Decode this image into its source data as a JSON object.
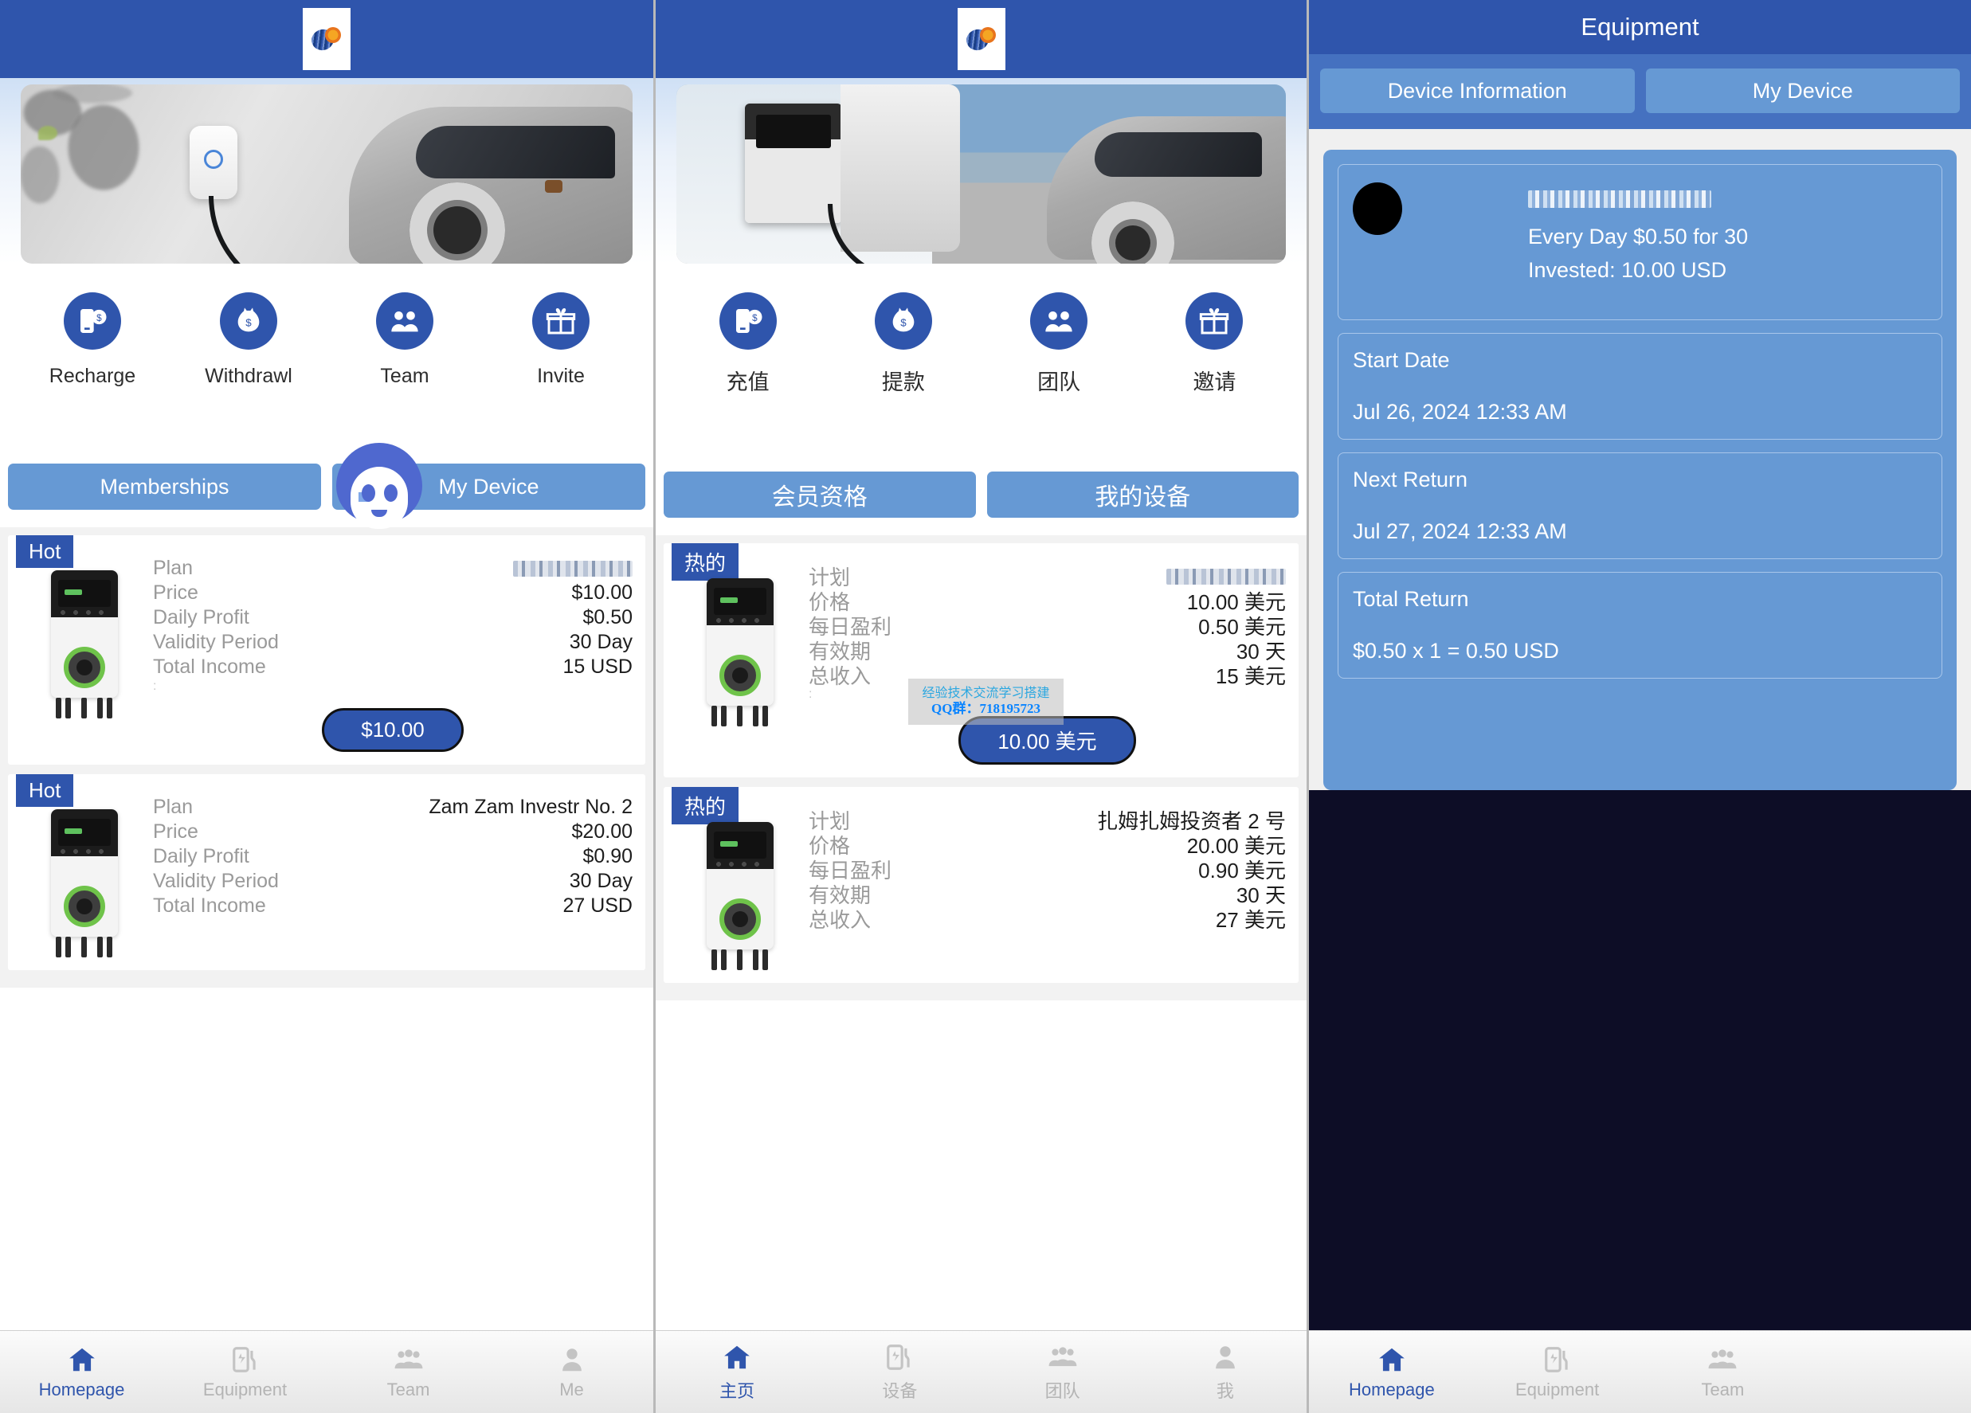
{
  "app": {
    "logo_name": "solar-globe-logo",
    "accent": "#2f55ac",
    "tab_blue": "#6699d4",
    "page_bg": "#f2f2f2"
  },
  "watermark": {
    "line1": "经验技术交流学习搭建",
    "line2": "QQ群：718195723"
  },
  "panel_en": {
    "actions": [
      {
        "label": "Recharge",
        "icon": "phone-dollar-icon"
      },
      {
        "label": "Withdrawl",
        "icon": "money-bag-icon"
      },
      {
        "label": "Team",
        "icon": "people-group-icon"
      },
      {
        "label": "Invite",
        "icon": "gift-icon"
      }
    ],
    "tabs": [
      {
        "label": "Memberships",
        "active": true
      },
      {
        "label": "My Device",
        "active": false
      }
    ],
    "plans": [
      {
        "badge": "Hot",
        "rows": [
          {
            "key": "Plan",
            "value": "",
            "blurred": true
          },
          {
            "key": "Price",
            "value": "$10.00",
            "blurred": false
          },
          {
            "key": "Daily Profit",
            "value": "$0.50",
            "blurred": false
          },
          {
            "key": "Validity Period",
            "value": "30 Day",
            "blurred": false
          },
          {
            "key": "Total Income",
            "value": "15 USD",
            "blurred": false
          }
        ],
        "buy_label": "$10.00"
      },
      {
        "badge": "Hot",
        "rows": [
          {
            "key": "Plan",
            "value": "Zam Zam Investr No. 2",
            "blurred": false
          },
          {
            "key": "Price",
            "value": "$20.00",
            "blurred": false
          },
          {
            "key": "Daily Profit",
            "value": "$0.90",
            "blurred": false
          },
          {
            "key": "Validity Period",
            "value": "30 Day",
            "blurred": false
          },
          {
            "key": "Total Income",
            "value": "27 USD",
            "blurred": false
          }
        ],
        "buy_label": ""
      }
    ],
    "nav": [
      {
        "label": "Homepage",
        "icon": "home-icon",
        "active": true
      },
      {
        "label": "Equipment",
        "icon": "charger-icon",
        "active": false
      },
      {
        "label": "Team",
        "icon": "people-icon",
        "active": false
      },
      {
        "label": "Me",
        "icon": "person-icon",
        "active": false
      }
    ]
  },
  "panel_zh": {
    "actions": [
      {
        "label": "充值",
        "icon": "phone-dollar-icon"
      },
      {
        "label": "提款",
        "icon": "money-bag-icon"
      },
      {
        "label": "团队",
        "icon": "people-group-icon"
      },
      {
        "label": "邀请",
        "icon": "gift-icon"
      }
    ],
    "tabs": [
      {
        "label": "会员资格",
        "active": true
      },
      {
        "label": "我的设备",
        "active": false
      }
    ],
    "plans": [
      {
        "badge": "热的",
        "rows": [
          {
            "key": "计划",
            "value": "",
            "blurred": true
          },
          {
            "key": "价格",
            "value": "10.00 美元",
            "blurred": false
          },
          {
            "key": "每日盈利",
            "value": "0.50 美元",
            "blurred": false
          },
          {
            "key": "有效期",
            "value": "30 天",
            "blurred": false
          },
          {
            "key": "总收入",
            "value": "15 美元",
            "blurred": false
          }
        ],
        "buy_label": "10.00 美元"
      },
      {
        "badge": "热的",
        "rows": [
          {
            "key": "计划",
            "value": "扎姆扎姆投资者 2 号",
            "blurred": false
          },
          {
            "key": "价格",
            "value": "20.00 美元",
            "blurred": false
          },
          {
            "key": "每日盈利",
            "value": "0.90 美元",
            "blurred": false
          },
          {
            "key": "有效期",
            "value": "30 天",
            "blurred": false
          },
          {
            "key": "总收入",
            "value": "27 美元",
            "blurred": false
          }
        ],
        "buy_label": ""
      }
    ],
    "nav": [
      {
        "label": "主页",
        "icon": "home-icon",
        "active": true
      },
      {
        "label": "设备",
        "icon": "charger-icon",
        "active": false
      },
      {
        "label": "团队",
        "icon": "people-icon",
        "active": false
      },
      {
        "label": "我",
        "icon": "person-icon",
        "active": false
      }
    ]
  },
  "panel_eq": {
    "title": "Equipment",
    "tabs": [
      {
        "label": "Device Information",
        "active": false
      },
      {
        "label": "My Device",
        "active": true
      }
    ],
    "device": {
      "name_blurred": true,
      "rate_line": "Every Day $0.50 for 30",
      "invested_line": "Invested: 10.00 USD"
    },
    "details": [
      {
        "label": "Start Date",
        "value": "Jul 26, 2024 12:33 AM"
      },
      {
        "label": "Next Return",
        "value": "Jul 27, 2024 12:33 AM"
      },
      {
        "label": "Total Return",
        "value": "$0.50 x 1 = 0.50 USD"
      }
    ],
    "nav": [
      {
        "label": "Homepage",
        "icon": "home-icon",
        "active": true
      },
      {
        "label": "Equipment",
        "icon": "charger-icon",
        "active": false
      },
      {
        "label": "Team",
        "icon": "people-icon",
        "active": false
      }
    ]
  }
}
